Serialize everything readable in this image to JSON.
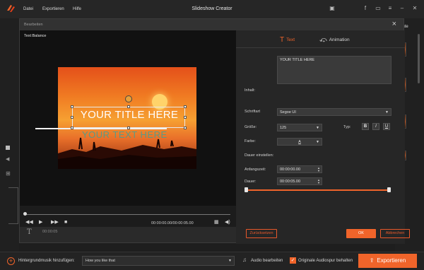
{
  "window": {
    "title": "Slideshow Creator",
    "menu": [
      "Datei",
      "Exportieren",
      "Hilfe"
    ]
  },
  "background": {
    "right_label": "ente"
  },
  "dialog": {
    "title": "Bearbeiten",
    "preview": {
      "label": "Text:Balance",
      "main_title": "YOUR TITLE HERE",
      "shadow_title": "YOUR TEXT HERE"
    },
    "player": {
      "time": "00:00:00.00/00:00:05.00",
      "track_time": "00:00:05"
    },
    "tabs": {
      "text": "Text",
      "animation": "Animation"
    },
    "form": {
      "inhalt_label": "Inhalt:",
      "inhalt_value": "YOUR TITLE HERE",
      "schriftart_label": "Schriftart",
      "schriftart_value": "Segoe UI",
      "groesse_label": "Größe:",
      "groesse_value": "125",
      "typ_label": "Typ:",
      "typ_buttons": [
        "B",
        "I",
        "U"
      ],
      "farbe_label": "Farbe:",
      "farbe_value": "A",
      "dauer_einstellen_label": "Dauer einstellen:",
      "anfangszeit_label": "Anfangszeit:",
      "anfangszeit_value": "00:00:00.00",
      "dauer_label": "Dauer:",
      "dauer_value": "00:00:05.00"
    },
    "buttons": {
      "reset": "Zurücksetzen",
      "ok": "OK",
      "cancel": "Abbrechen"
    }
  },
  "bottombar": {
    "music_label": "Hintergrundmusik hinzufügen:",
    "music_value": "How you like that",
    "audio_edit": "Audio bearbeiten",
    "keep_audio": "Originale Audiospur behalten",
    "export": "Exportieren"
  },
  "colors": {
    "accent": "#f0642a",
    "title_text": "#ffffff",
    "shadow_text": "#2aa5a5"
  }
}
